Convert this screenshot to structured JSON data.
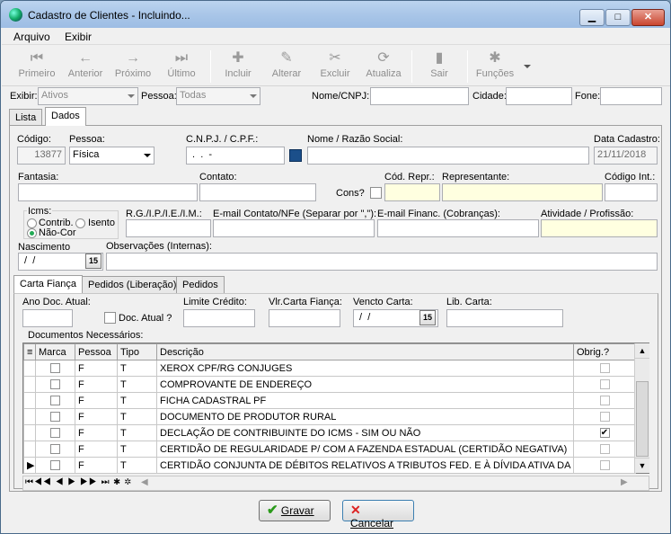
{
  "window": {
    "title": "Cadastro de Clientes - Incluindo...",
    "min": "▁",
    "max": "□",
    "close": "✕"
  },
  "menu": [
    "Arquivo",
    "Exibir"
  ],
  "toolbar": [
    {
      "label": "Primeiro",
      "icon": "⏮"
    },
    {
      "label": "Anterior",
      "icon": "←"
    },
    {
      "label": "Próximo",
      "icon": "→"
    },
    {
      "label": "Último",
      "icon": "⏭"
    },
    {
      "label": "Incluir",
      "icon": "✚"
    },
    {
      "label": "Alterar",
      "icon": "✎"
    },
    {
      "label": "Excluir",
      "icon": "✂"
    },
    {
      "label": "Atualiza",
      "icon": "⟳"
    },
    {
      "label": "Sair",
      "icon": "▮"
    },
    {
      "label": "Funções",
      "icon": "✱"
    }
  ],
  "filter": {
    "exibir_label": "Exibir:",
    "exibir_value": "Ativos",
    "pessoa_label": "Pessoa:",
    "pessoa_value": "Todas",
    "nome_label": "Nome/CNPJ:",
    "cidade_label": "Cidade:",
    "fone_label": "Fone:"
  },
  "tabs": [
    "Lista",
    "Dados"
  ],
  "form": {
    "codigo_label": "Código:",
    "codigo_value": "13877",
    "pessoa_label": "Pessoa:",
    "pessoa_value": "Física",
    "cnpj_label": "C.N.P.J. / C.P.F.:",
    "cnpj_value": " .  .  -",
    "nome_label": "Nome / Razão Social:",
    "data_label": "Data Cadastro:",
    "data_value": "21/11/2018",
    "fantasia_label": "Fantasia:",
    "contato_label": "Contato:",
    "cons_label": "Cons?",
    "codrepr_label": "Cód. Repr.:",
    "repres_label": "Representante:",
    "codint_label": "Código Int.:",
    "icms_label": "Icms:",
    "contrib_label": "Contrib.",
    "isento_label": "Isento",
    "naocon_label": "Não-Cor",
    "rg_label": "R.G./I.P./I.E./I.M.:",
    "email_label": "E-mail Contato/NFe (Separar por \",\"):",
    "emailfin_label": "E-mail Financ. (Cobranças):",
    "ativ_label": "Atividade / Profissão:",
    "nasc_label": "Nascimento",
    "nasc_value": " /  /",
    "obs_label": "Observações (Internas):"
  },
  "subtabs": [
    "Carta Fiança",
    "Pedidos (Liberação)",
    "Pedidos"
  ],
  "carta": {
    "ano_label": "Ano Doc. Atual:",
    "docatual_label": "Doc. Atual ?",
    "limite_label": "Limite Crédito:",
    "vlr_label": "Vlr.Carta Fiança:",
    "vencto_label": "Vencto Carta:",
    "vencto_value": " /  /",
    "lib_label": "Lib. Carta:",
    "docs_label": "Documentos Necessários:"
  },
  "grid": {
    "headers": [
      "Marca",
      "Pessoa",
      "Tipo",
      "Descrição",
      "Obrig.?"
    ],
    "rows": [
      {
        "pessoa": "F",
        "tipo": "T",
        "desc": "XEROX CPF/RG CONJUGES",
        "obrig": false
      },
      {
        "pessoa": "F",
        "tipo": "T",
        "desc": "COMPROVANTE DE ENDEREÇO",
        "obrig": false
      },
      {
        "pessoa": "F",
        "tipo": "T",
        "desc": "FICHA CADASTRAL PF",
        "obrig": false
      },
      {
        "pessoa": "F",
        "tipo": "T",
        "desc": "DOCUMENTO DE PRODUTOR RURAL",
        "obrig": false
      },
      {
        "pessoa": "F",
        "tipo": "T",
        "desc": "DECLAÇÃO DE CONTRIBUINTE DO ICMS - SIM OU NÃO",
        "obrig": true
      },
      {
        "pessoa": "F",
        "tipo": "T",
        "desc": "CERTIDÃO DE REGULARIDADE P/ COM A FAZENDA ESTADUAL (CERTIDÃO NEGATIVA)",
        "obrig": false
      },
      {
        "pessoa": "F",
        "tipo": "T",
        "desc": "CERTIDÃO CONJUNTA DE DÉBITOS RELATIVOS A TRIBUTOS FED. E À DÍVIDA ATIVA DA U",
        "obrig": false
      }
    ],
    "nav": "⏮◀◀ ◀ ▶ ▶▶ ⏭ ✱ ✲"
  },
  "buttons": {
    "gravar": "Gravar",
    "cancelar": "Cancelar"
  }
}
